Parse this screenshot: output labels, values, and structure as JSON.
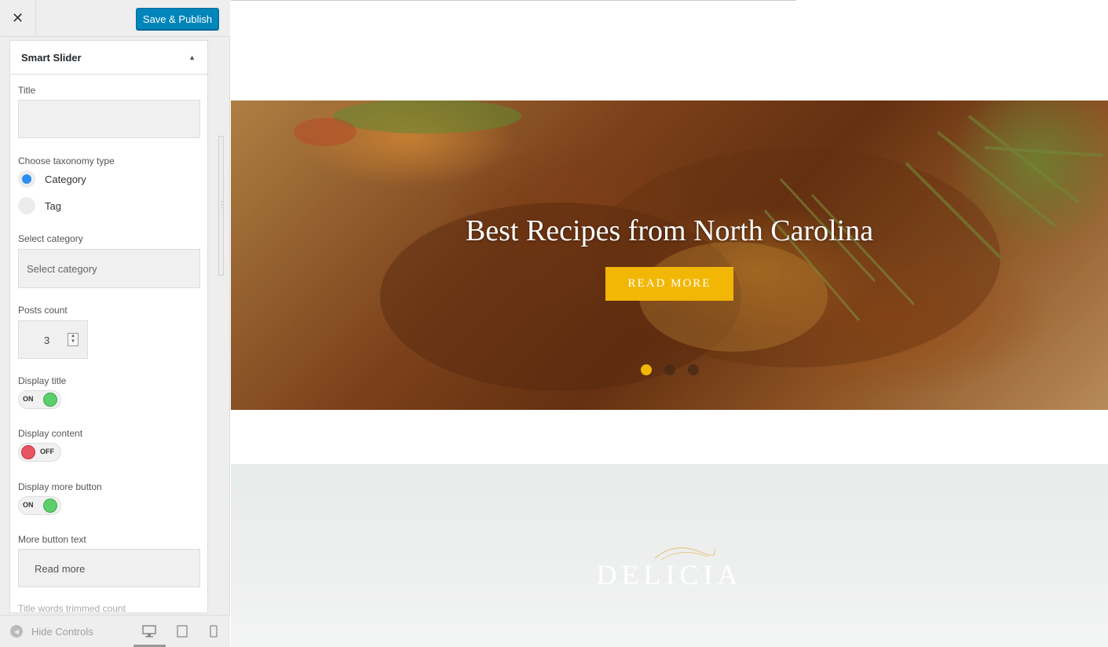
{
  "topbar": {
    "close_label": "✕",
    "publish_label": "Save & Publish"
  },
  "panel": {
    "title": "Smart Slider",
    "title_field": {
      "label": "Title",
      "value": ""
    },
    "taxonomy": {
      "label": "Choose taxonomy type",
      "options": [
        "Category",
        "Tag"
      ],
      "selected": "Category"
    },
    "category": {
      "label": "Select category",
      "placeholder": "Select category"
    },
    "posts_count": {
      "label": "Posts count",
      "value": "3"
    },
    "display_title": {
      "label": "Display title",
      "state": "ON"
    },
    "display_content": {
      "label": "Display content",
      "state": "OFF"
    },
    "display_more": {
      "label": "Display more button",
      "state": "ON"
    },
    "more_text": {
      "label": "More button text",
      "value": "Read more"
    },
    "trimmed": {
      "label": "Title words trimmed count"
    }
  },
  "bottombar": {
    "hide_label": "Hide Controls",
    "devices": [
      "desktop-icon",
      "tablet-icon",
      "mobile-icon"
    ]
  },
  "preview": {
    "hero_title": "Best Recipes from North Carolina",
    "button_label": "READ MORE",
    "slides": 3,
    "active_slide": 1,
    "logo": "DELICIA"
  },
  "colors": {
    "accent": "#0085ba",
    "button": "#f2b705",
    "toggle_on": "#5ccf6d",
    "toggle_off": "#e65563",
    "radio": "#2d8cf0"
  }
}
